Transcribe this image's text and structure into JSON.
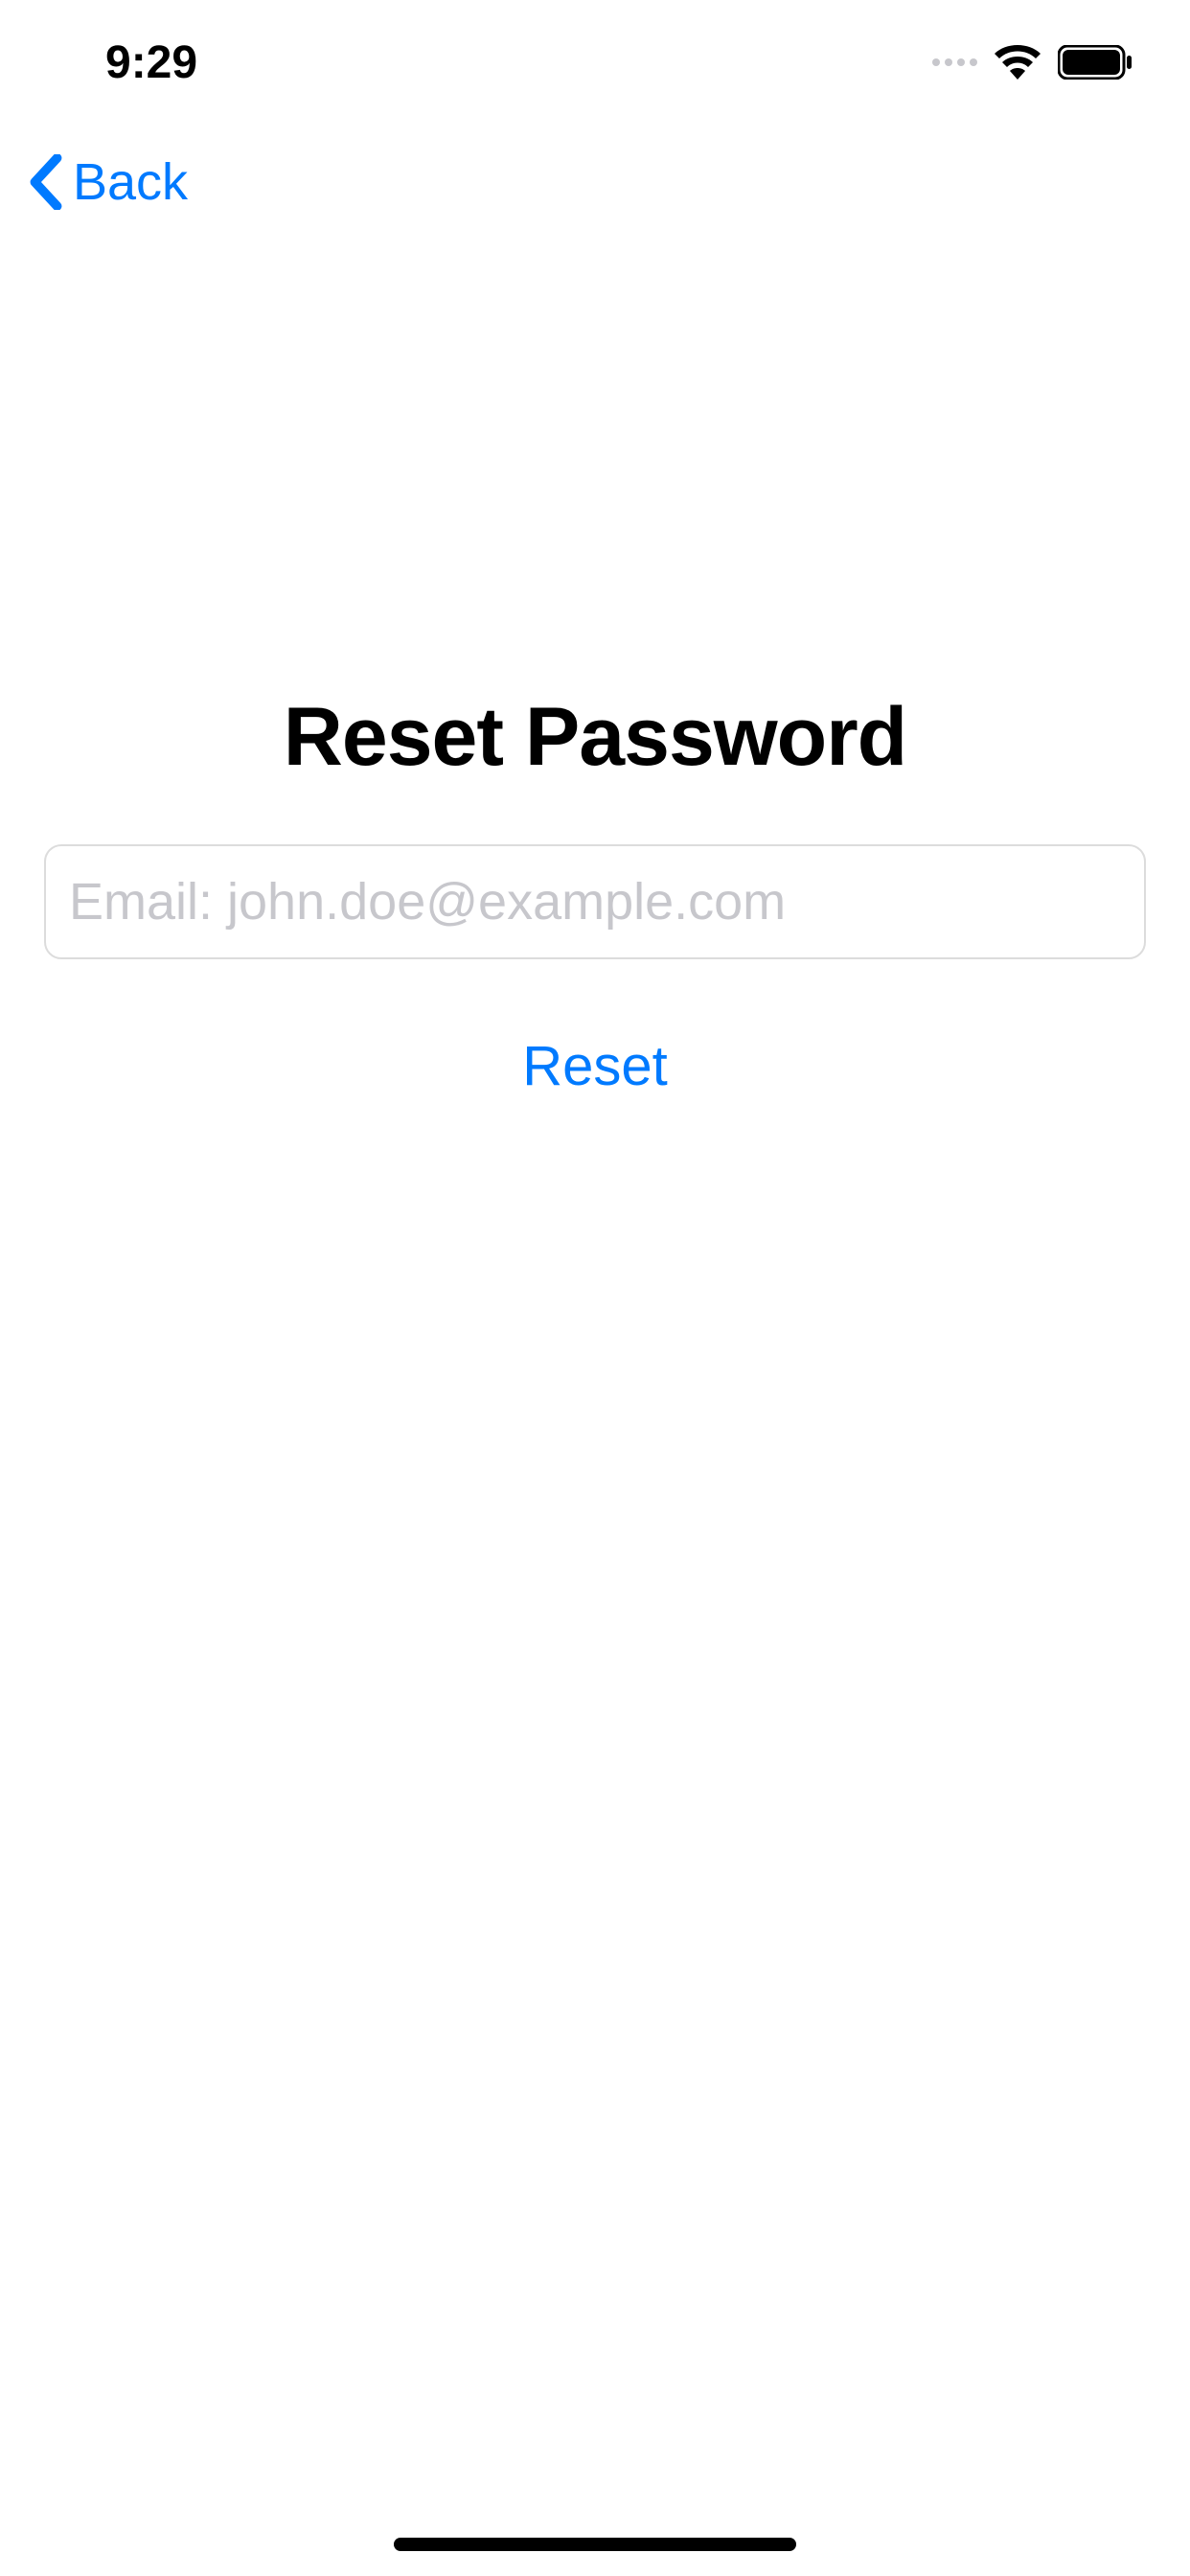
{
  "statusBar": {
    "time": "9:29"
  },
  "navBar": {
    "backLabel": "Back"
  },
  "content": {
    "title": "Reset Password",
    "emailPlaceholder": "Email: john.doe@example.com",
    "resetButtonLabel": "Reset"
  }
}
